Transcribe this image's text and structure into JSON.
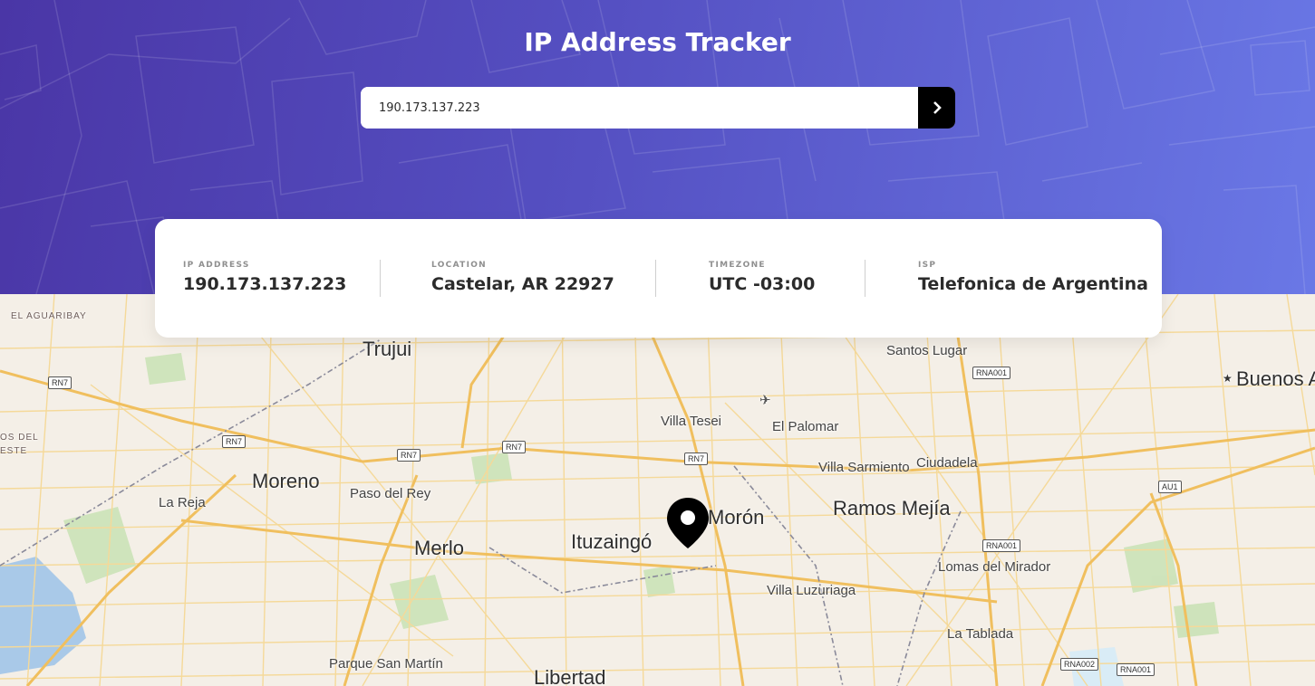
{
  "header": {
    "title": "IP Address Tracker",
    "search_value": "190.173.137.223",
    "submit_icon": "chevron-right-icon"
  },
  "info": {
    "ip_label": "IP ADDRESS",
    "ip_value": "190.173.137.223",
    "location_label": "LOCATION",
    "location_value": "Castelar, AR 22927",
    "timezone_label": "TIMEZONE",
    "timezone_value": "UTC -03:00",
    "isp_label": "ISP",
    "isp_value": "Telefonica de Argentina"
  },
  "map": {
    "marker_icon": "location-pin-icon",
    "places": [
      {
        "name": "EL AGUARIBAY"
      },
      {
        "name": "Trujui"
      },
      {
        "name": "Santos Lugar"
      },
      {
        "name": "Buenos A"
      },
      {
        "name": "OS DEL"
      },
      {
        "name": "ESTE"
      },
      {
        "name": "Villa Tesei"
      },
      {
        "name": "El Palomar"
      },
      {
        "name": "Villa Sarmiento"
      },
      {
        "name": "Ciudadela"
      },
      {
        "name": "Moreno"
      },
      {
        "name": "Paso del Rey"
      },
      {
        "name": "La Reja"
      },
      {
        "name": "Ramos Mejía"
      },
      {
        "name": "Morón"
      },
      {
        "name": "Ituzaingó"
      },
      {
        "name": "Merlo"
      },
      {
        "name": "Lomas del Mirador"
      },
      {
        "name": "Villa Luzuriaga"
      },
      {
        "name": "La Tablada"
      },
      {
        "name": "Parque San Martín"
      },
      {
        "name": "Libertad"
      }
    ],
    "shields": [
      "RN7",
      "RN7",
      "RN7",
      "RN7",
      "RN7",
      "RNA001",
      "AU1",
      "RNA001",
      "RNA002",
      "RNA001"
    ]
  },
  "colors": {
    "header_start": "#4a36a6",
    "header_end": "#6a78e6",
    "button": "#000000",
    "road": "#f3c96a",
    "map_bg": "#f4efe7"
  }
}
